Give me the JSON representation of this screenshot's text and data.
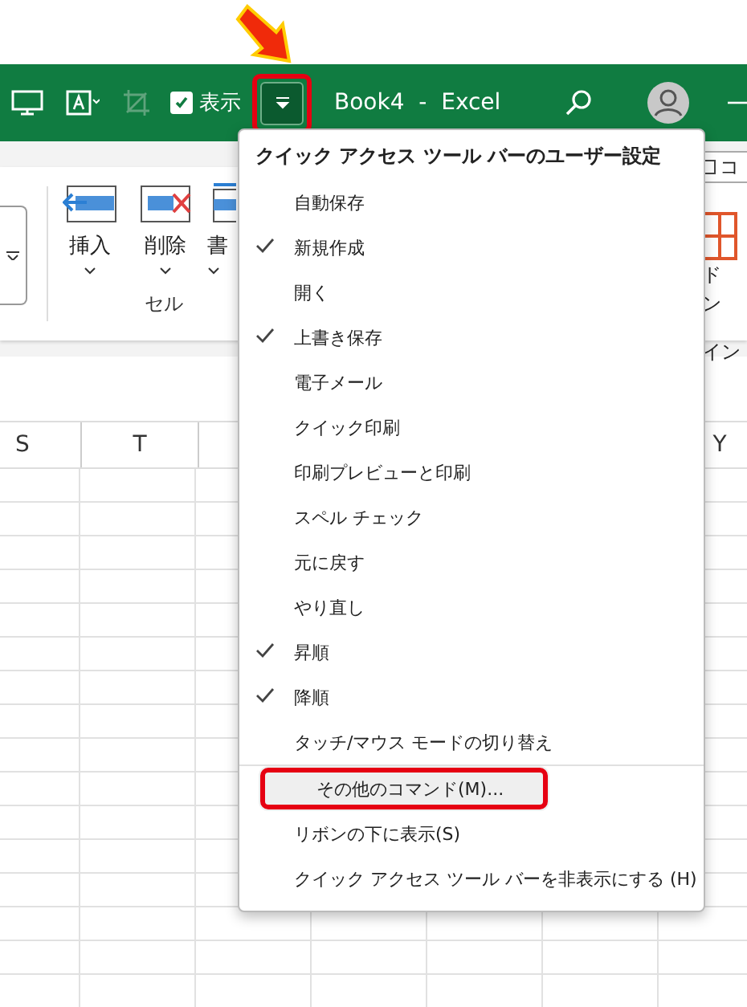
{
  "annotation_arrow": true,
  "title_bar": {
    "checkbox": {
      "label": "表示",
      "checked": true
    },
    "qat_button": {
      "annotated": true,
      "selected": true
    },
    "title": "Book4  -  Excel"
  },
  "ribbon": {
    "buttons": [
      {
        "label": "挿入",
        "kind": "insert"
      },
      {
        "label": "削除",
        "kind": "delete"
      },
      {
        "label": "書",
        "kind": "format"
      }
    ],
    "group_label": "セル",
    "right_button": "コ",
    "addin_label": [
      "ド",
      "ン"
    ],
    "addin_group_label": "イン"
  },
  "sheet": {
    "columns": [
      {
        "label": "S"
      },
      {
        "label": "T"
      },
      {
        "label": "Y"
      }
    ]
  },
  "menu": {
    "title": "クイック アクセス ツール バーのユーザー設定",
    "items": [
      {
        "label": "自動保存",
        "checked": false,
        "highlighted": false,
        "annotated": false
      },
      {
        "label": "新規作成",
        "checked": true,
        "highlighted": false,
        "annotated": false
      },
      {
        "label": "開く",
        "checked": false,
        "highlighted": false,
        "annotated": false
      },
      {
        "label": "上書き保存",
        "checked": true,
        "highlighted": false,
        "annotated": false
      },
      {
        "label": "電子メール",
        "checked": false,
        "highlighted": false,
        "annotated": false
      },
      {
        "label": "クイック印刷",
        "checked": false,
        "highlighted": false,
        "annotated": false
      },
      {
        "label": "印刷プレビューと印刷",
        "checked": false,
        "highlighted": false,
        "annotated": false
      },
      {
        "label": "スペル チェック",
        "checked": false,
        "highlighted": false,
        "annotated": false
      },
      {
        "label": "元に戻す",
        "checked": false,
        "highlighted": false,
        "annotated": false
      },
      {
        "label": "やり直し",
        "checked": false,
        "highlighted": false,
        "annotated": false
      },
      {
        "label": "昇順",
        "checked": true,
        "highlighted": false,
        "annotated": false
      },
      {
        "label": "降順",
        "checked": true,
        "highlighted": false,
        "annotated": false
      },
      {
        "label": "タッチ/マウス モードの切り替え",
        "checked": false,
        "highlighted": false,
        "annotated": false,
        "divider_after": true
      },
      {
        "label": "その他のコマンド(M)...",
        "checked": false,
        "highlighted": true,
        "annotated": true
      },
      {
        "label": "リボンの下に表示(S)",
        "checked": false,
        "highlighted": false,
        "annotated": false
      },
      {
        "label": "クイック アクセス ツール バーを非表示にする (H)",
        "checked": false,
        "highlighted": false,
        "annotated": false
      }
    ]
  }
}
